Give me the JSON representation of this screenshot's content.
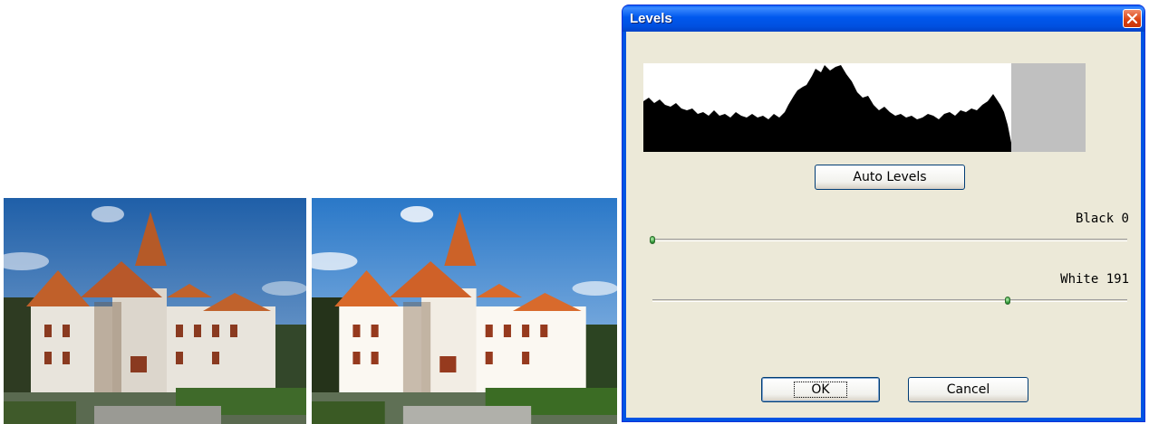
{
  "dialog": {
    "title": "Levels",
    "auto_levels_label": "Auto Levels",
    "black_label": "Black 0",
    "white_label": "White 191",
    "ok_label": "OK",
    "cancel_label": "Cancel"
  },
  "sliders": {
    "black": {
      "value": 0,
      "max": 255
    },
    "white": {
      "value": 191,
      "max": 255
    }
  },
  "icons": {
    "close": "close-icon"
  },
  "colors": {
    "titlebar": "#0054e3",
    "close_button": "#d9400f",
    "dialog_face": "#ece9d8",
    "histogram_fill": "#000000",
    "histogram_clipped": "#c0c0c0",
    "slider_thumb": "#3aa040"
  }
}
